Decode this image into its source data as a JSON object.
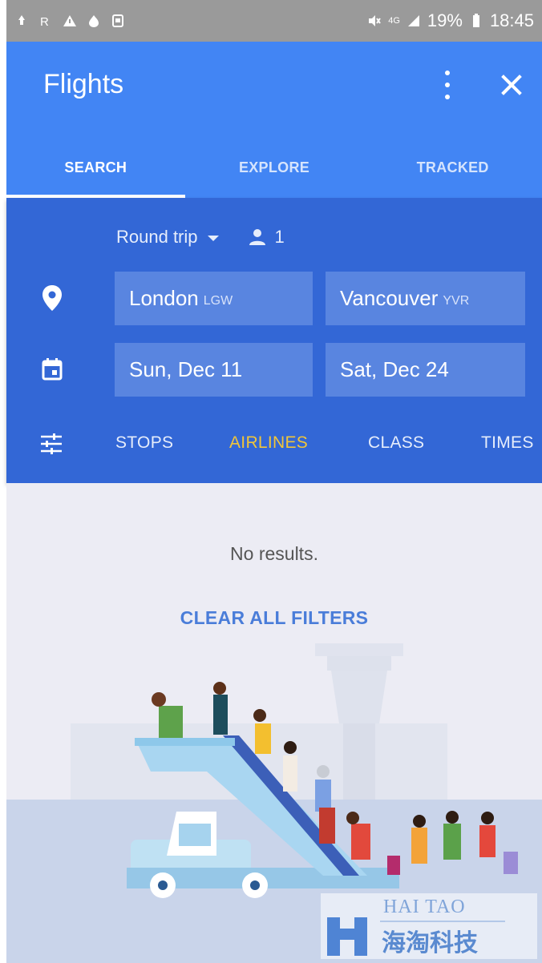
{
  "statusbar": {
    "signal_text": "4G",
    "battery": "19%",
    "time": "18:45"
  },
  "app": {
    "title": "Flights"
  },
  "tabs": [
    {
      "label": "SEARCH",
      "active": true
    },
    {
      "label": "EXPLORE",
      "active": false
    },
    {
      "label": "TRACKED",
      "active": false
    }
  ],
  "search": {
    "trip_type": "Round trip",
    "passengers": "1",
    "origin": {
      "city": "London",
      "code": "LGW"
    },
    "destination": {
      "city": "Vancouver",
      "code": "YVR"
    },
    "depart_date": "Sun, Dec 11",
    "return_date": "Sat, Dec 24"
  },
  "filters": [
    {
      "label": "STOPS",
      "active": false
    },
    {
      "label": "AIRLINES",
      "active": true
    },
    {
      "label": "CLASS",
      "active": false
    },
    {
      "label": "TIMES",
      "active": false
    }
  ],
  "results": {
    "message": "No results.",
    "clear_label": "CLEAR ALL FILTERS"
  },
  "watermark": {
    "line1": "HAI TAO",
    "line2": "海淘科技"
  },
  "colors": {
    "app_bar": "#4285f4",
    "panel": "#3367d6",
    "field": "#5985e0",
    "active_filter": "#f0c53a",
    "link": "#4a7dd9",
    "content_bg": "#ececf4"
  },
  "icons": [
    "location-pin-icon",
    "calendar-icon",
    "filter-sliders-icon",
    "person-icon",
    "more-vert-icon",
    "close-icon",
    "dropdown-caret-icon"
  ]
}
